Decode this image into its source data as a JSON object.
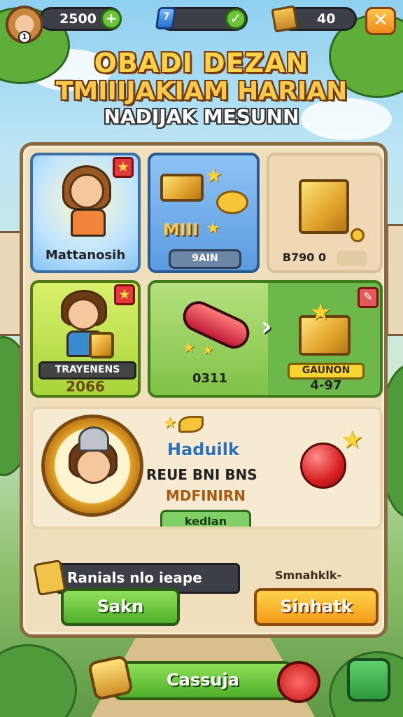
{
  "hud": {
    "coins_value": "2500",
    "coins_add_icon": "plus-icon",
    "gems_value": "7",
    "gems_icon": "gem-icon",
    "gems_confirm_icon": "check-icon",
    "crates_value": "40",
    "crates_icon": "crate-icon",
    "close_label": "✕",
    "avatar_level": "1"
  },
  "titles": {
    "line1": "OBADI DEZAN",
    "line2": "TMIIIJAKIAM HARIAN",
    "line3": "NADIJAK MESUNN"
  },
  "cards": {
    "hero_card": {
      "label": "Mattanosih",
      "badge_icon": "star-icon"
    },
    "chest_card": {
      "tag": "MIII",
      "button": "9AIN"
    },
    "block_card": {
      "value": "B790 0"
    },
    "training_card": {
      "title": "TRAYENENS",
      "value": "2066",
      "badge_icon": "star-icon"
    },
    "tool_card": {
      "value": "0311",
      "button_title": "GAUNON",
      "button_value": "4-97",
      "edit_icon": "pencil-icon"
    }
  },
  "feature": {
    "title": "Haduilk",
    "subtitle": "REUE BNI  BNS",
    "subtitle2": "MDFINIRN",
    "button": "kedlan"
  },
  "footer_panel": {
    "rent_label": "Ranials nlo ieape",
    "green_button": "Sakn",
    "caption": "Smnahklk-",
    "orange_button": "Sinhatk"
  },
  "bottom_bar": {
    "label": "Cassuja"
  }
}
